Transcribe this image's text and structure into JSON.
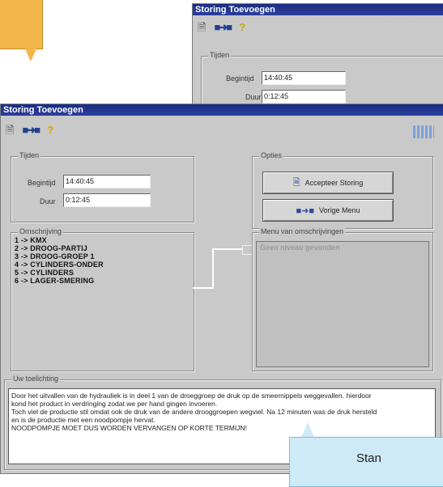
{
  "back_window": {
    "title": "Storing Toevoegen",
    "tijden": {
      "legend": "Tijden",
      "begintijd_label": "Begintijd",
      "begintijd_value": "14:40:45",
      "duur_label": "Duur",
      "duur_value": "0:12:45"
    }
  },
  "window": {
    "title": "Storing Toevoegen",
    "toolbar": {
      "doc_icon": "document-icon",
      "exit_icon": "exit-icon",
      "help_icon": "help-icon"
    },
    "tijden": {
      "legend": "Tijden",
      "begintijd_label": "Begintijd",
      "begintijd_value": "14:40:45",
      "duur_label": "Duur",
      "duur_value": "0:12:45"
    },
    "opties": {
      "legend": "Opties",
      "accept_label": "Accepteer Storing",
      "vorige_label": "Vorige Menu"
    },
    "omschrijving": {
      "legend": "Omschrijving",
      "items": [
        "1 -> KMX",
        "2 -> DROOG-PARTIJ",
        "3 -> DROOG-GROEP 1",
        "4 -> CYLINDERS-ONDER",
        "5 -> CYLINDERS",
        "6 -> LAGER-SMERING"
      ]
    },
    "menu": {
      "legend": "Menu van omschrijvingen",
      "empty_text": "Geen niveau gevonden"
    },
    "toelichting": {
      "legend": "Uw toelichting",
      "lines": [
        "Door het uitvallen van de hydrauliek is in deel 1 van de droeggroep de druk op de smeernippels weggevallen. hierdoor",
        "kond het product in verdringing zodat we per hand gingen invoeren.",
        "Toch viel de productie stil omdat ook de druk van de andere drooggroepen wegviel. Na 12 minuten was de druk hersteld",
        "en is de productie met een noodpompje hervat.",
        "NOODPOMPJE MOET DUS WORDEN VERVANGEN OP KORTE TERMIJN!"
      ]
    }
  },
  "callout": {
    "text": "Stan"
  },
  "colors": {
    "titlebar": "#1b2d82",
    "window_bg": "#c9c9c9",
    "callout_orange": "#f3b64a",
    "callout_blue": "#cfeaf7"
  }
}
